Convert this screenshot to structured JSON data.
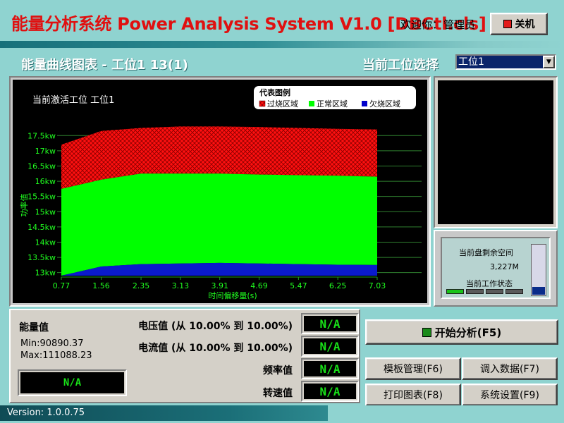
{
  "app": {
    "title": "能量分析系统 Power Analysis System V1.0 [DBCtl.cls]",
    "welcome_text": "欢迎你：",
    "user": "管理员",
    "shutdown_label": "关机"
  },
  "header": {
    "chart_section_title": "能量曲线图表 - 工位1  13(1)",
    "station_select_label": "当前工位选择",
    "station_select_value": "工位1"
  },
  "chart_data": {
    "type": "area",
    "title": "当前激活工位 工位1",
    "xlabel": "时间偏移量(s)",
    "ylabel": "功率值",
    "x_ticks": [
      "0.77",
      "1.56",
      "2.35",
      "3.13",
      "3.91",
      "4.69",
      "5.47",
      "6.25",
      "7.03"
    ],
    "y_ticks": [
      "13kw",
      "13.5kw",
      "14kw",
      "14.5kw",
      "15kw",
      "15.5kw",
      "16kw",
      "16.5kw",
      "17kw",
      "17.5kw"
    ],
    "ylim": [
      12.9,
      17.9
    ],
    "xlim": [
      0.77,
      7.03
    ],
    "legend": {
      "title": "代表图例",
      "placement": "top-right",
      "items": [
        {
          "name": "过烧区域",
          "color": "#ff0000"
        },
        {
          "name": "正常区域",
          "color": "#00ff00"
        },
        {
          "name": "欠烧区域",
          "color": "#0000cc"
        }
      ]
    },
    "x": [
      0.77,
      1.56,
      2.35,
      3.13,
      3.91,
      4.69,
      5.47,
      6.25,
      7.03
    ],
    "series": [
      {
        "name": "过烧区域",
        "upper": [
          17.2,
          17.65,
          17.75,
          17.8,
          17.8,
          17.78,
          17.75,
          17.72,
          17.7
        ],
        "lower": [
          15.75,
          16.05,
          16.25,
          16.25,
          16.25,
          16.22,
          16.2,
          16.18,
          16.15
        ]
      },
      {
        "name": "正常区域",
        "upper": [
          15.75,
          16.05,
          16.25,
          16.25,
          16.25,
          16.22,
          16.2,
          16.18,
          16.15
        ],
        "lower": [
          12.9,
          13.2,
          13.28,
          13.3,
          13.32,
          13.3,
          13.28,
          13.26,
          13.25
        ]
      },
      {
        "name": "欠烧区域",
        "upper": [
          12.9,
          13.2,
          13.28,
          13.3,
          13.32,
          13.3,
          13.28,
          13.26,
          13.25
        ],
        "lower": [
          12.9,
          12.9,
          12.9,
          12.9,
          12.9,
          12.9,
          12.9,
          12.9,
          12.9
        ]
      }
    ],
    "grid": true
  },
  "disk": {
    "label": "当前盘剩余空间",
    "value": "3,227M",
    "status_label": "当前工作状态",
    "used_fraction": 0.15,
    "leds_on": 1,
    "leds_total": 4
  },
  "energy": {
    "title": "能量值",
    "min": "Min:90890.37",
    "max": "Max:111088.23",
    "value": "N/A"
  },
  "measurements": [
    {
      "label": "电压值 (从 10.00% 到 10.00%)",
      "value": "N/A"
    },
    {
      "label": "电流值 (从 10.00% 到 10.00%)",
      "value": "N/A"
    },
    {
      "label": "频率值",
      "value": "N/A"
    },
    {
      "label": "转速值",
      "value": "N/A"
    }
  ],
  "actions": {
    "start": "开始分析(F5)",
    "template": "模板管理(F6)",
    "import": "调入数据(F7)",
    "print": "打印图表(F8)",
    "settings": "系统设置(F9)"
  },
  "status": {
    "version": "Version: 1.0.0.75"
  },
  "colors": {
    "background": "#8fd3d0",
    "title_red": "#e01010",
    "lcd_green": "#18e018"
  }
}
